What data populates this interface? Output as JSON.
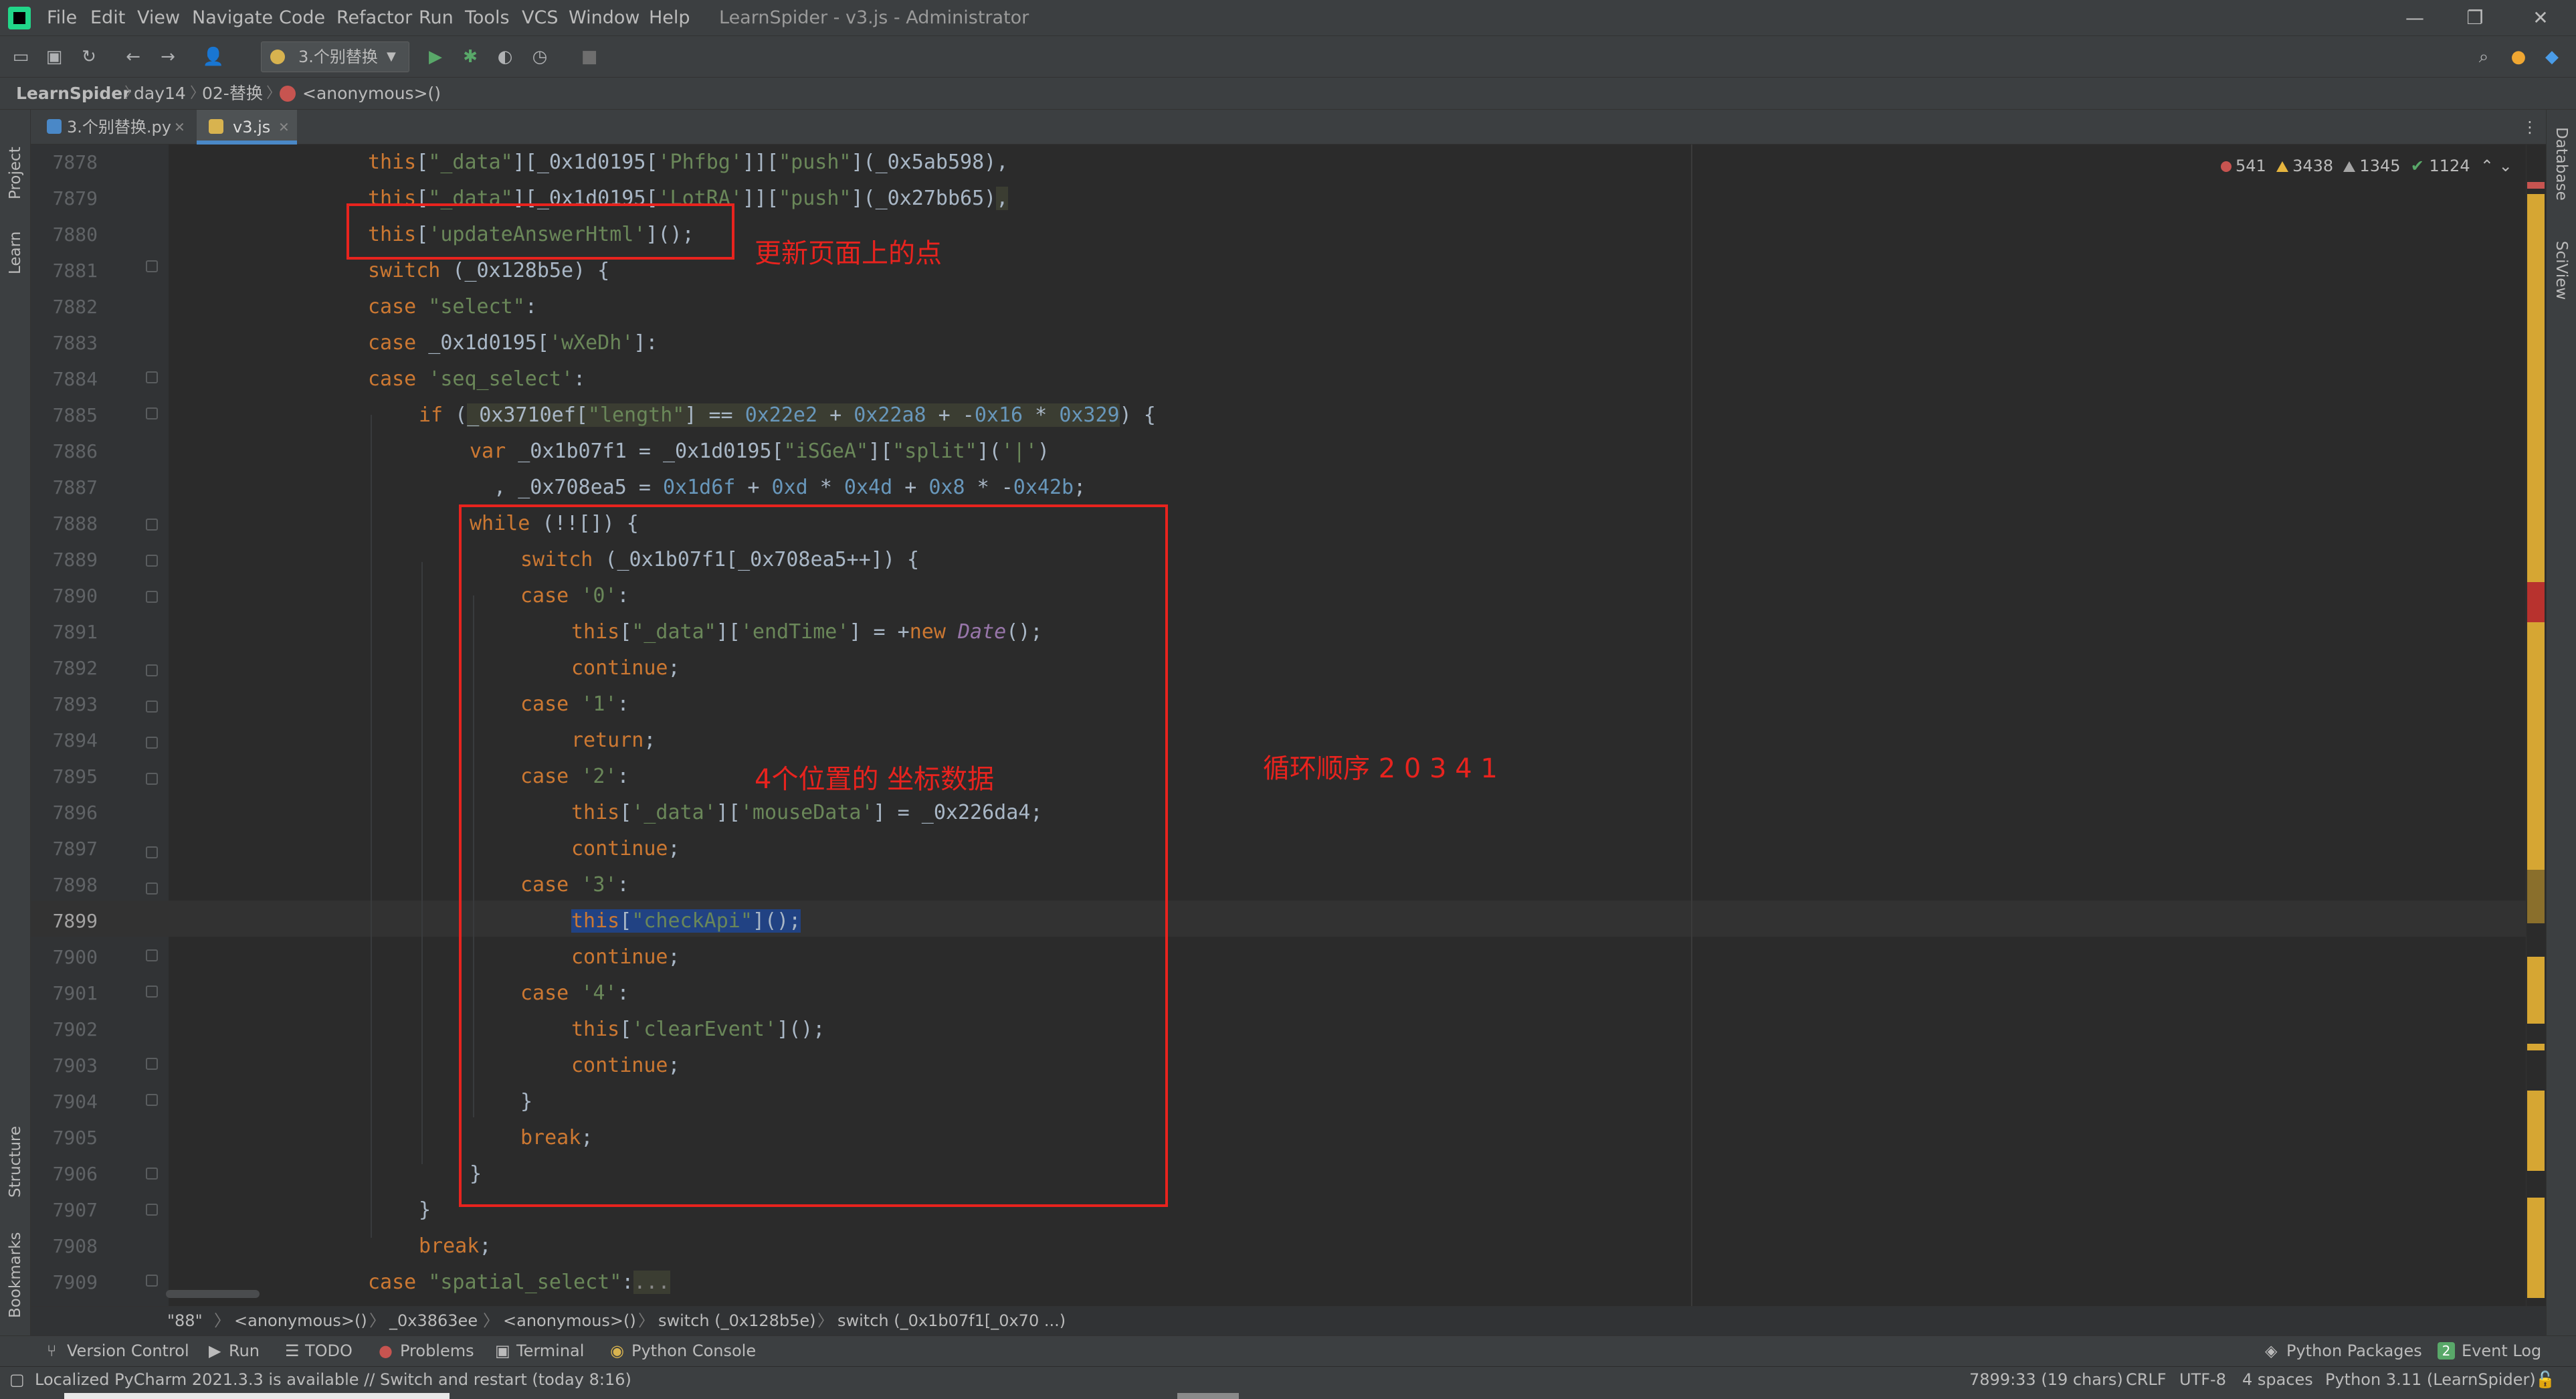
{
  "window": {
    "title": "LearnSpider - v3.js - Administrator",
    "controls": [
      "—",
      "❐",
      "✕"
    ]
  },
  "menu": [
    "File",
    "Edit",
    "View",
    "Navigate",
    "Code",
    "Refactor",
    "Run",
    "Tools",
    "VCS",
    "Window",
    "Help"
  ],
  "toolbar": {
    "run_config": "3.个别替换"
  },
  "breadcrumb": [
    "LearnSpider",
    "day14",
    "02-替换",
    "<anonymous>()"
  ],
  "tabs": [
    {
      "label": "3.个别替换.py",
      "active": false
    },
    {
      "label": "v3.js",
      "active": true
    }
  ],
  "left_tools": [
    "Project",
    "Learn",
    "Structure",
    "Bookmarks"
  ],
  "right_tools": [
    "Database",
    "SciView"
  ],
  "inspections": {
    "errors": "541",
    "warnings": "3438",
    "weak_warnings": "1345",
    "ok": "1124"
  },
  "editor": {
    "current_line": "7899",
    "line_numbers": [
      "7878",
      "7879",
      "7880",
      "7881",
      "7882",
      "7883",
      "7884",
      "7885",
      "7886",
      "7887",
      "7888",
      "7889",
      "7890",
      "7891",
      "7892",
      "7893",
      "7894",
      "7895",
      "7896",
      "7897",
      "7898",
      "7899",
      "7900",
      "7901",
      "7902",
      "7903",
      "7904",
      "7905",
      "7906",
      "7907",
      "7908",
      "7909"
    ]
  },
  "annotations": {
    "update_label": "更新页面上的点",
    "coords_label": "4个位置的 坐标数据",
    "order_label": "循环顺序 2 0 3 4 1"
  },
  "structure_crumbs": [
    "\"88\"",
    "<anonymous>()",
    "_0x3863ee",
    "<anonymous>()",
    "switch (_0x128b5e)",
    "switch (_0x1b07f1[_0x70 ...)"
  ],
  "tool_windows": {
    "left": [
      "Version Control",
      "Run",
      "TODO",
      "Problems",
      "Terminal",
      "Python Console"
    ],
    "right": [
      "Python Packages",
      "Event Log"
    ],
    "event_count": "2"
  },
  "status": {
    "message": "Localized PyCharm 2021.3.3 is available // Switch and restart (today 8:16)",
    "position": "7899:33 (19 chars)",
    "line_sep": "CRLF",
    "encoding": "UTF-8",
    "indent": "4 spaces",
    "interpreter": "Python 3.11 (LearnSpider)"
  }
}
